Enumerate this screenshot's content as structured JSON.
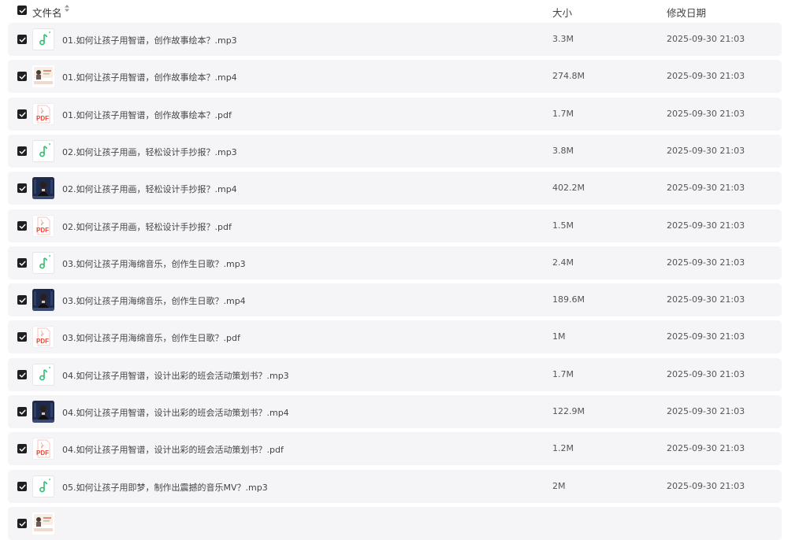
{
  "header": {
    "col_name": "文件名",
    "col_size": "大小",
    "col_date": "修改日期",
    "sort_icon": "sort-icon"
  },
  "colors": {
    "row_bg": "#f5f5f7",
    "checkbox": "#1f1f1f",
    "audio_icon": "#2fbf71",
    "pdf_icon": "#e84a3c"
  },
  "files": [
    {
      "name": "01.如何让孩子用智谱，创作故事绘本？.mp3",
      "size": "3.3M",
      "date": "2025-09-30 21:03",
      "type": "audio"
    },
    {
      "name": "01.如何让孩子用智谱，创作故事绘本？.mp4",
      "size": "274.8M",
      "date": "2025-09-30 21:03",
      "type": "video-a"
    },
    {
      "name": "01.如何让孩子用智谱，创作故事绘本？.pdf",
      "size": "1.7M",
      "date": "2025-09-30 21:03",
      "type": "pdf"
    },
    {
      "name": "02.如何让孩子用画，轻松设计手抄报？.mp3",
      "size": "3.8M",
      "date": "2025-09-30 21:03",
      "type": "audio"
    },
    {
      "name": "02.如何让孩子用画，轻松设计手抄报？.mp4",
      "size": "402.2M",
      "date": "2025-09-30 21:03",
      "type": "video-b"
    },
    {
      "name": "02.如何让孩子用画，轻松设计手抄报？.pdf",
      "size": "1.5M",
      "date": "2025-09-30 21:03",
      "type": "pdf"
    },
    {
      "name": "03.如何让孩子用海绵音乐，创作生日歌？.mp3",
      "size": "2.4M",
      "date": "2025-09-30 21:03",
      "type": "audio"
    },
    {
      "name": "03.如何让孩子用海绵音乐，创作生日歌？.mp4",
      "size": "189.6M",
      "date": "2025-09-30 21:03",
      "type": "video-b"
    },
    {
      "name": "03.如何让孩子用海绵音乐，创作生日歌？.pdf",
      "size": "1M",
      "date": "2025-09-30 21:03",
      "type": "pdf"
    },
    {
      "name": "04.如何让孩子用智谱，设计出彩的班会活动策划书？.mp3",
      "size": "1.7M",
      "date": "2025-09-30 21:03",
      "type": "audio"
    },
    {
      "name": "04.如何让孩子用智谱，设计出彩的班会活动策划书？.mp4",
      "size": "122.9M",
      "date": "2025-09-30 21:03",
      "type": "video-b"
    },
    {
      "name": "04.如何让孩子用智谱，设计出彩的班会活动策划书？.pdf",
      "size": "1.2M",
      "date": "2025-09-30 21:03",
      "type": "pdf"
    },
    {
      "name": "05.如何让孩子用即梦，制作出震撼的音乐MV？.mp3",
      "size": "2M",
      "date": "2025-09-30 21:03",
      "type": "audio"
    },
    {
      "name": "",
      "size": "",
      "date": "",
      "type": "video-a"
    }
  ]
}
